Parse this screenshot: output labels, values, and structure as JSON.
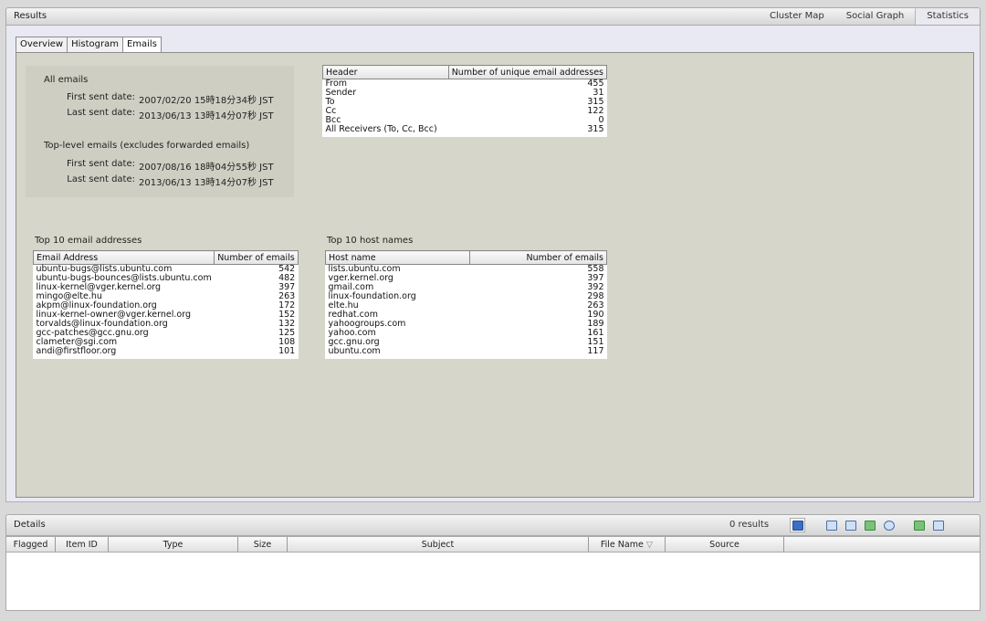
{
  "results": {
    "title": "Results",
    "view_tabs": [
      "Cluster Map",
      "Social Graph",
      "Statistics"
    ],
    "active_view": "Statistics",
    "sub_tabs": [
      "Overview",
      "Histogram",
      "Emails"
    ],
    "active_sub_tab": "Emails"
  },
  "summary": {
    "all_title": "All emails",
    "all_first_label": "First sent date:",
    "all_first_value": "2007/02/20 15時18分34秒 JST",
    "all_last_label": "Last sent date:",
    "all_last_value": "2013/06/13 13時14分07秒 JST",
    "top_title": "Top-level emails (excludes forwarded emails)",
    "top_first_label": "First sent date:",
    "top_first_value": "2007/08/16 18時04分55秒 JST",
    "top_last_label": "Last sent date:",
    "top_last_value": "2013/06/13 13時14分07秒 JST"
  },
  "header_table": {
    "columns": [
      "Header",
      "Number of unique email addresses"
    ],
    "rows": [
      [
        "From",
        "455"
      ],
      [
        "Sender",
        "31"
      ],
      [
        "To",
        "315"
      ],
      [
        "Cc",
        "122"
      ],
      [
        "Bcc",
        "0"
      ],
      [
        "All Receivers (To, Cc, Bcc)",
        "315"
      ]
    ]
  },
  "top_emails": {
    "caption": "Top 10 email addresses",
    "columns": [
      "Email Address",
      "Number of emails"
    ],
    "rows": [
      [
        "ubuntu-bugs@lists.ubuntu.com",
        "542"
      ],
      [
        "ubuntu-bugs-bounces@lists.ubuntu.com",
        "482"
      ],
      [
        "linux-kernel@vger.kernel.org",
        "397"
      ],
      [
        "mingo@elte.hu",
        "263"
      ],
      [
        "akpm@linux-foundation.org",
        "172"
      ],
      [
        "linux-kernel-owner@vger.kernel.org",
        "152"
      ],
      [
        "torvalds@linux-foundation.org",
        "132"
      ],
      [
        "gcc-patches@gcc.gnu.org",
        "125"
      ],
      [
        "clameter@sgi.com",
        "108"
      ],
      [
        "andi@firstfloor.org",
        "101"
      ]
    ]
  },
  "top_hosts": {
    "caption": "Top 10 host names",
    "columns": [
      "Host name",
      "Number of emails"
    ],
    "rows": [
      [
        "lists.ubuntu.com",
        "558"
      ],
      [
        "vger.kernel.org",
        "397"
      ],
      [
        "gmail.com",
        "392"
      ],
      [
        "linux-foundation.org",
        "298"
      ],
      [
        "elte.hu",
        "263"
      ],
      [
        "redhat.com",
        "190"
      ],
      [
        "yahoogroups.com",
        "189"
      ],
      [
        "yahoo.com",
        "161"
      ],
      [
        "gcc.gnu.org",
        "151"
      ],
      [
        "ubuntu.com",
        "117"
      ]
    ]
  },
  "details": {
    "title": "Details",
    "results_count": "0 results",
    "columns": [
      "Flagged",
      "Item ID",
      "Type",
      "Size",
      "Subject",
      "File Name",
      "Source"
    ],
    "filter_icon": "▽",
    "toolbar_icons": [
      "tree-view-icon",
      "table-view-icon",
      "list-view-icon",
      "image-view-icon",
      "timeline-icon",
      "tag-icon",
      "export-icon"
    ]
  }
}
